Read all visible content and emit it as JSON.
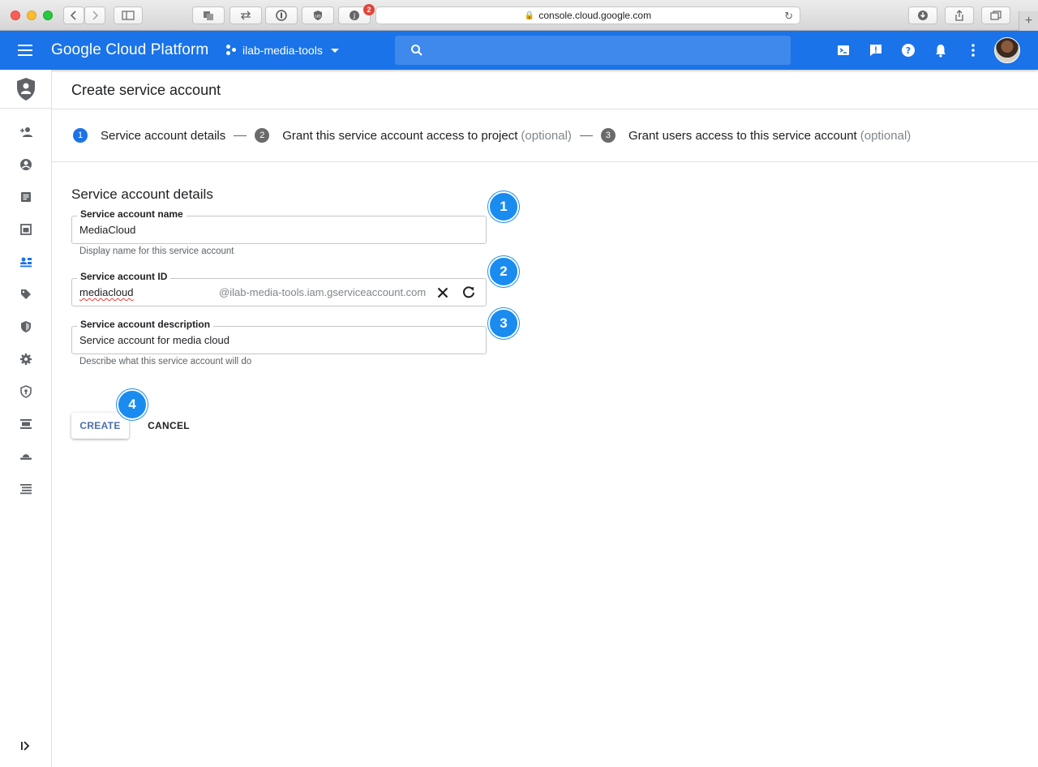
{
  "browser": {
    "url": "console.cloud.google.com",
    "extension_badge": "2"
  },
  "header": {
    "brand": "Google Cloud Platform",
    "project": "ilab-media-tools",
    "search_placeholder": ""
  },
  "page": {
    "title": "Create service account"
  },
  "stepper": {
    "steps": [
      {
        "num": "1",
        "label": "Service account details",
        "optional": ""
      },
      {
        "num": "2",
        "label": "Grant this service account access to project",
        "optional": "(optional)"
      },
      {
        "num": "3",
        "label": "Grant users access to this service account",
        "optional": "(optional)"
      }
    ]
  },
  "form": {
    "section_title": "Service account details",
    "name": {
      "label": "Service account name",
      "value": "MediaCloud",
      "helper": "Display name for this service account"
    },
    "id": {
      "label": "Service account ID",
      "value": "mediacloud",
      "suffix": "@ilab-media-tools.iam.gserviceaccount.com"
    },
    "description": {
      "label": "Service account description",
      "value": "Service account for media cloud",
      "helper": "Describe what this service account will do"
    },
    "create_label": "CREATE",
    "cancel_label": "CANCEL"
  },
  "callouts": [
    "1",
    "2",
    "3",
    "4"
  ],
  "colors": {
    "header_blue": "#1a73e8",
    "callout_blue": "#1a8cf0",
    "step_active": "#1a73e8"
  },
  "nav_icons": [
    "security-shield-icon",
    "add-person-icon",
    "account-circle-icon",
    "document-icon",
    "calendar-icon",
    "service-accounts-icon",
    "tag-icon",
    "shield-icon",
    "gear-icon",
    "security-check-icon",
    "list-icon",
    "hat-icon",
    "lines-icon",
    "expand-icon"
  ]
}
